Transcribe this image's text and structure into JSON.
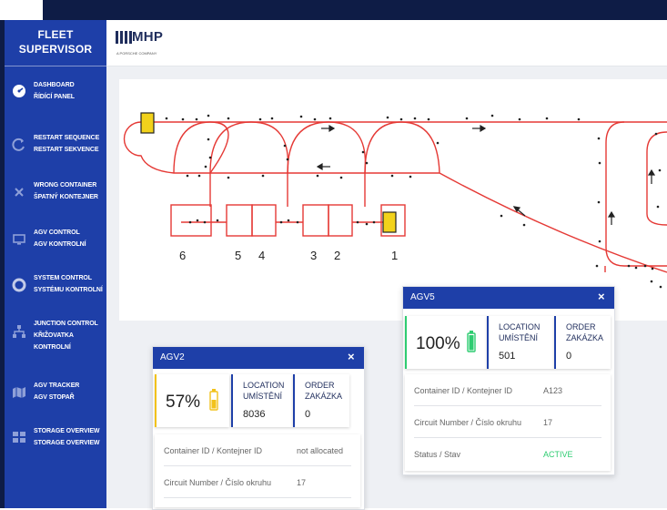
{
  "brand": {
    "line1": "FLEET",
    "line2": "SUPERVISOR"
  },
  "sidebar": {
    "items": [
      {
        "line1": "DASHBOARD",
        "line2": "ŘÍDÍCÍ PANEL",
        "icon": "dashboard-icon"
      },
      {
        "line1": "RESTART SEQUENCE",
        "line2": "RESTART SEKVENCE",
        "icon": "restart-icon"
      },
      {
        "line1": "WRONG CONTAINER",
        "line2": "ŠPATNÝ KONTEJNER",
        "icon": "close-icon"
      },
      {
        "line1": "AGV CONTROL",
        "line2": "AGV KONTROLNÍ",
        "icon": "monitor-icon"
      },
      {
        "line1": "SYSTEM CONTROL",
        "line2": "SYSTÉMU KONTROLNÍ",
        "icon": "circle-icon"
      },
      {
        "line1": "JUNCTION CONTROL",
        "line2": "KŘIŽOVATKA",
        "line3": "KONTROLNÍ",
        "icon": "network-icon"
      },
      {
        "line1": "AGV TRACKER",
        "line2": "AGV STOPAŘ",
        "icon": "map-icon"
      },
      {
        "line1": "STORAGE OVERVIEW",
        "line2": "STORAGE OVERVIEW",
        "icon": "storage-icon"
      }
    ]
  },
  "header": {
    "logo": "MHP",
    "logo_sub": "A PORSCHE COMPANY"
  },
  "map": {
    "station_labels": [
      "6",
      "5",
      "4",
      "3",
      "2",
      "1"
    ],
    "track_color": "#e53935",
    "agv_color": "#f2d21b"
  },
  "agv2": {
    "title": "AGV2",
    "close": "×",
    "battery": "57%",
    "location_label_1": "LOCATION",
    "location_label_2": "UMÍSTĚNÍ",
    "location_value": "8036",
    "order_label_1": "ORDER",
    "order_label_2": "ZAKÁZKA",
    "order_value": "0",
    "rows": [
      {
        "key": "Container ID / Kontejner ID",
        "value": "not allocated"
      },
      {
        "key": "Circuit Number / Číslo okruhu",
        "value": "17"
      }
    ],
    "accent": "#f2c21b"
  },
  "agv5": {
    "title": "AGV5",
    "close": "×",
    "battery": "100%",
    "location_label_1": "LOCATION",
    "location_label_2": "UMÍSTĚNÍ",
    "location_value": "501",
    "order_label_1": "ORDER",
    "order_label_2": "ZAKÁZKA",
    "order_value": "0",
    "rows": [
      {
        "key": "Container ID / Kontejner ID",
        "value": "A123"
      },
      {
        "key": "Circuit Number / Číslo okruhu",
        "value": "17"
      },
      {
        "key": "Status / Stav",
        "value": "ACTIVE"
      }
    ],
    "accent": "#2ecc71"
  }
}
